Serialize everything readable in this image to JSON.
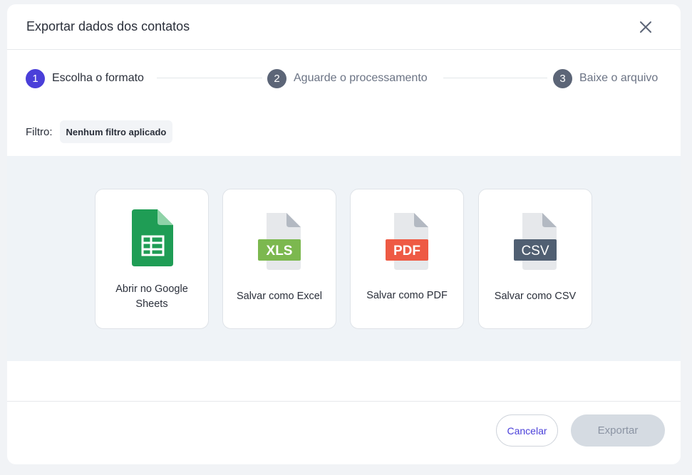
{
  "modal": {
    "title": "Exportar dados dos contatos",
    "close_icon": "close-icon"
  },
  "stepper": {
    "steps": [
      {
        "number": "1",
        "label": "Escolha o formato",
        "state": "active"
      },
      {
        "number": "2",
        "label": "Aguarde o processamento",
        "state": "pending"
      },
      {
        "number": "3",
        "label": "Baixe o arquivo",
        "state": "pending"
      }
    ]
  },
  "filter": {
    "label": "Filtro:",
    "value": "Nenhum filtro aplicado"
  },
  "formats": [
    {
      "label": "Abrir no Google Sheets",
      "icon": "google-sheets-icon",
      "badge": ""
    },
    {
      "label": "Salvar como Excel",
      "icon": "xls-file-icon",
      "badge": "XLS",
      "color": "#7cb84f"
    },
    {
      "label": "Salvar como PDF",
      "icon": "pdf-file-icon",
      "badge": "PDF",
      "color": "#ee5a44"
    },
    {
      "label": "Salvar como CSV",
      "icon": "csv-file-icon",
      "badge": "CSV",
      "color": "#505f72"
    }
  ],
  "colors": {
    "accent": "#4a3fd9",
    "sheets_green": "#1f9d55",
    "panel_bg": "#eff3f7"
  },
  "footer": {
    "cancel_label": "Cancelar",
    "export_label": "Exportar"
  }
}
